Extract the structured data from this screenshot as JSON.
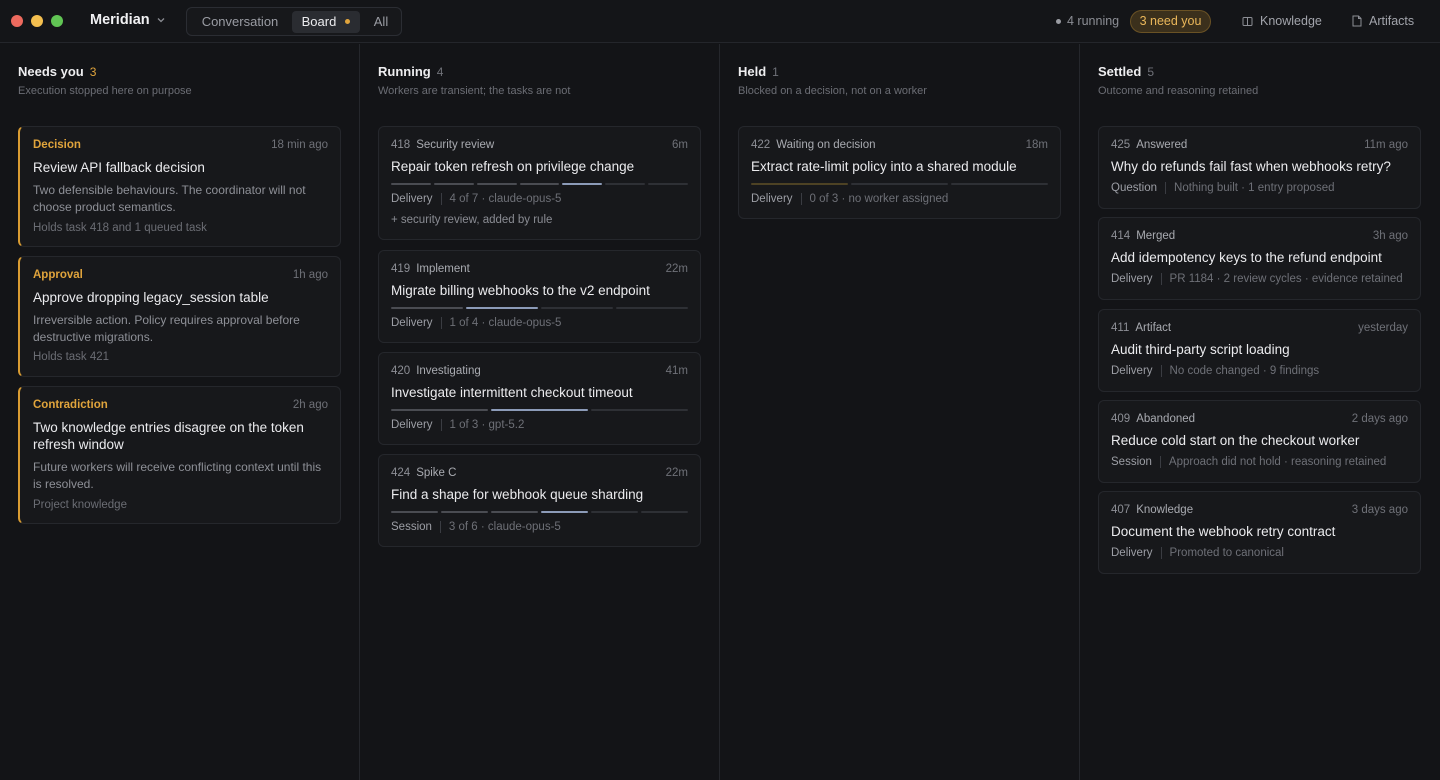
{
  "app": {
    "name": "Meridian"
  },
  "tabs": [
    "Conversation",
    "Board",
    "All"
  ],
  "status": {
    "running": "4 running",
    "need_you": "3 need you"
  },
  "links": {
    "knowledge": "Knowledge",
    "artifacts": "Artifacts"
  },
  "colors": {
    "accent": "#e0a43c",
    "progress_active": "#8c9bb8",
    "background": "#131417"
  },
  "columns": [
    {
      "title": "Needs you",
      "count": "3",
      "subtitle": "Execution stopped here on purpose",
      "cards": [
        {
          "type": "Decision",
          "time": "18 min ago",
          "title": "Review API fallback decision",
          "desc": "Two defensible behaviours. The coordinator will not choose product semantics.",
          "foot": "Holds task 418 and 1 queued task"
        },
        {
          "type": "Approval",
          "time": "1h ago",
          "title": "Approve dropping legacy_session table",
          "desc": "Irreversible action. Policy requires approval before destructive migrations.",
          "foot": "Holds task 421"
        },
        {
          "type": "Contradiction",
          "time": "2h ago",
          "title": "Two knowledge entries disagree on the token refresh window",
          "desc": "Future workers will receive conflicting context until this is resolved.",
          "foot": "Project knowledge"
        }
      ]
    },
    {
      "title": "Running",
      "count": "4",
      "subtitle": "Workers are transient; the tasks are not",
      "cards": [
        {
          "id": "418",
          "stage": "Security review",
          "time": "6m",
          "title": "Repair token refresh on privilege change",
          "kind": "Delivery",
          "meta": "4 of 7 · claude-opus-5",
          "extra": "+ security review, added by rule",
          "progress": {
            "total": 7,
            "done": 4,
            "active": 5
          }
        },
        {
          "id": "419",
          "stage": "Implement",
          "time": "22m",
          "title": "Migrate billing webhooks to the v2 endpoint",
          "kind": "Delivery",
          "meta": "1 of 4 · claude-opus-5",
          "progress": {
            "total": 4,
            "done": 1,
            "active": 2
          }
        },
        {
          "id": "420",
          "stage": "Investigating",
          "time": "41m",
          "title": "Investigate intermittent checkout timeout",
          "kind": "Delivery",
          "meta": "1 of 3 · gpt-5.2",
          "progress": {
            "total": 3,
            "done": 1,
            "active": 2
          }
        },
        {
          "id": "424",
          "stage": "Spike C",
          "time": "22m",
          "title": "Find a shape for webhook queue sharding",
          "kind": "Session",
          "meta": "3 of 6 · claude-opus-5",
          "progress": {
            "total": 6,
            "done": 3,
            "active": 4
          }
        }
      ]
    },
    {
      "title": "Held",
      "count": "1",
      "subtitle": "Blocked on a decision, not on a worker",
      "cards": [
        {
          "id": "422",
          "stage": "Waiting on decision",
          "time": "18m",
          "title": "Extract rate-limit policy into a shared module",
          "kind": "Delivery",
          "meta": "0 of 3 · no worker assigned",
          "progress": {
            "total": 3,
            "done": 0,
            "held": 1
          }
        }
      ]
    },
    {
      "title": "Settled",
      "count": "5",
      "subtitle": "Outcome and reasoning retained",
      "cards": [
        {
          "id": "425",
          "stage": "Answered",
          "time": "11m ago",
          "title": "Why do refunds fail fast when webhooks retry?",
          "kind": "Question",
          "meta": "Nothing built · 1 entry proposed"
        },
        {
          "id": "414",
          "stage": "Merged",
          "time": "3h ago",
          "title": "Add idempotency keys to the refund endpoint",
          "kind": "Delivery",
          "meta": "PR 1184 · 2 review cycles · evidence retained"
        },
        {
          "id": "411",
          "stage": "Artifact",
          "time": "yesterday",
          "title": "Audit third-party script loading",
          "kind": "Delivery",
          "meta": "No code changed · 9 findings"
        },
        {
          "id": "409",
          "stage": "Abandoned",
          "time": "2 days ago",
          "title": "Reduce cold start on the checkout worker",
          "kind": "Session",
          "meta": "Approach did not hold · reasoning retained"
        },
        {
          "id": "407",
          "stage": "Knowledge",
          "time": "3 days ago",
          "title": "Document the webhook retry contract",
          "kind": "Delivery",
          "meta": "Promoted to canonical"
        }
      ]
    }
  ]
}
